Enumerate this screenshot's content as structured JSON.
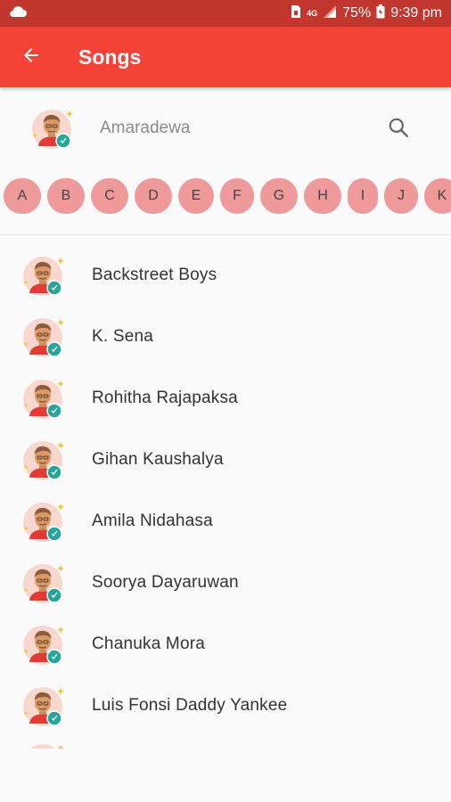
{
  "status_bar": {
    "network_label": "4G",
    "battery": "75%",
    "time": "9:39 pm",
    "icons": [
      "cloud-icon",
      "sim-icon",
      "signal-icon",
      "battery-icon"
    ]
  },
  "app_bar": {
    "title": "Songs",
    "back_icon": "arrow-back-icon",
    "color": "#f44336"
  },
  "search": {
    "value": "Amaradewa",
    "icon": "search-icon"
  },
  "alphabet": [
    {
      "letter": "A",
      "w": 42
    },
    {
      "letter": "B",
      "w": 42
    },
    {
      "letter": "C",
      "w": 42
    },
    {
      "letter": "D",
      "w": 42
    },
    {
      "letter": "E",
      "w": 40
    },
    {
      "letter": "F",
      "w": 38
    },
    {
      "letter": "G",
      "w": 42
    },
    {
      "letter": "H",
      "w": 42
    },
    {
      "letter": "I",
      "w": 34
    },
    {
      "letter": "J",
      "w": 38
    },
    {
      "letter": "K",
      "w": 40
    }
  ],
  "artists": [
    "Backstreet Boys",
    "K. Sena",
    "Rohitha Rajapaksa",
    "Gihan Kaushalya",
    "Amila Nidahasa",
    "Soorya Dayaruwan",
    "Chanuka Mora",
    "Luis Fonsi  Daddy Yankee"
  ],
  "accent_colors": {
    "status_bar": "#c1372d",
    "chip": "#ef9a9a",
    "avatar_bg": "#f8d7cf",
    "avatar_shirt": "#e53935",
    "avatar_badge": "#26a69a"
  }
}
